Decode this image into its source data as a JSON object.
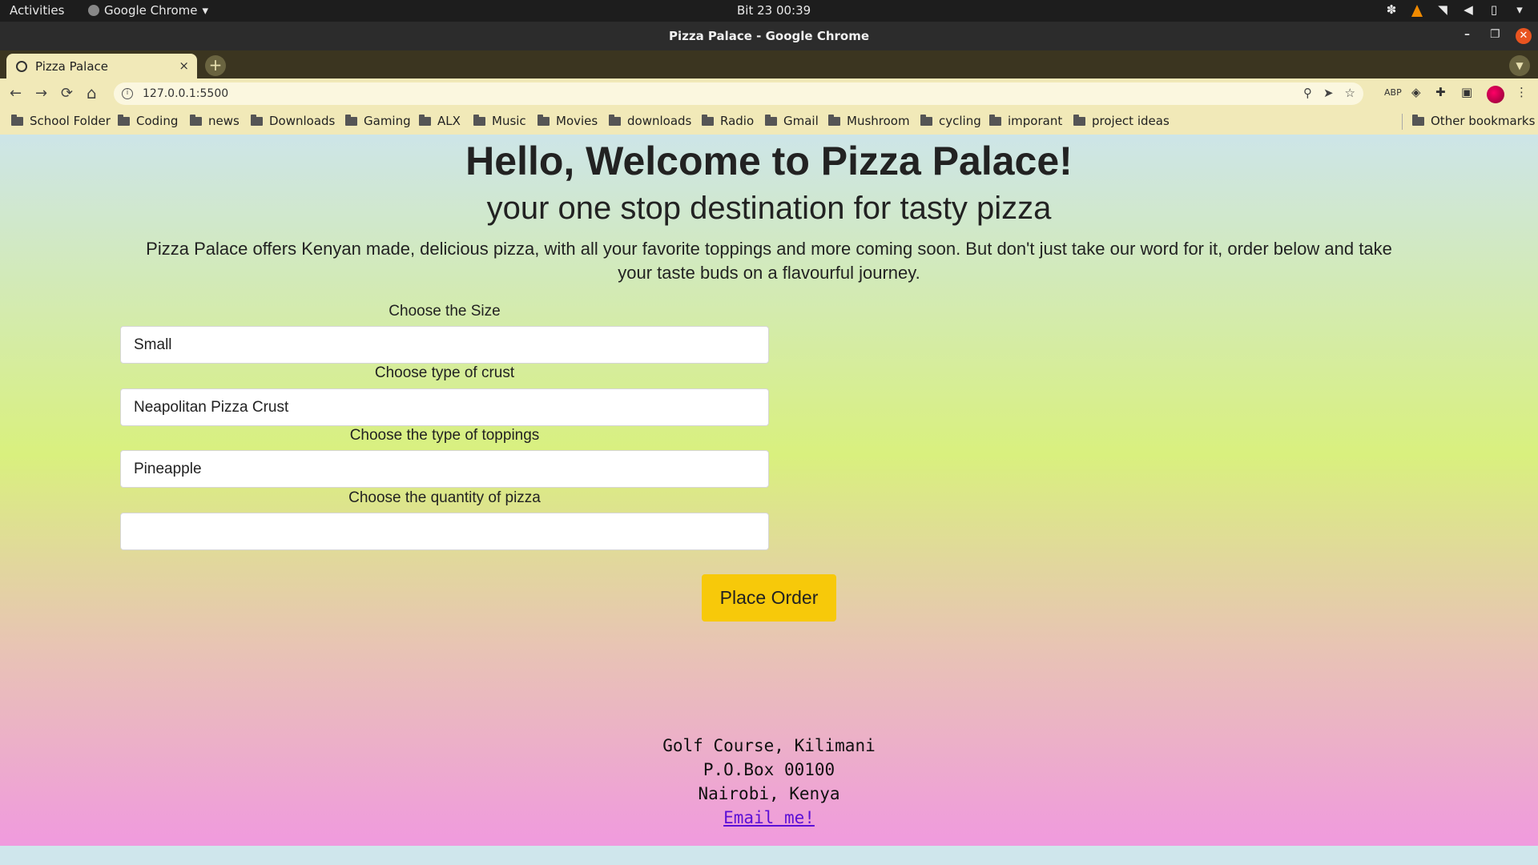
{
  "os": {
    "activities": "Activities",
    "app_name": "Google Chrome",
    "clock": "Bit 23  00:39"
  },
  "window": {
    "title": "Pizza Palace - Google Chrome"
  },
  "tab": {
    "title": "Pizza Palace",
    "close": "×"
  },
  "toolbar": {
    "url": "127.0.0.1:5500",
    "back": "←",
    "forward": "→",
    "reload": "⟳",
    "home": "⌂"
  },
  "bookmarks": [
    {
      "label": "School Folder"
    },
    {
      "label": "Coding"
    },
    {
      "label": "news"
    },
    {
      "label": "Downloads"
    },
    {
      "label": "Gaming"
    },
    {
      "label": "ALX"
    },
    {
      "label": "Music"
    },
    {
      "label": "Movies"
    },
    {
      "label": "downloads"
    },
    {
      "label": "Radio"
    },
    {
      "label": "Gmail"
    },
    {
      "label": "Mushroom"
    },
    {
      "label": "cycling"
    },
    {
      "label": "imporant"
    },
    {
      "label": "project ideas"
    }
  ],
  "other_bookmarks": "Other bookmarks",
  "page": {
    "heading": "Hello, Welcome to Pizza Palace!",
    "subheading": "your one stop destination for tasty pizza",
    "intro": "Pizza Palace offers Kenyan made, delicious pizza, with all your favorite toppings and more coming soon. But don't just take our word for it, order below and take your taste buds on a flavourful journey.",
    "form": {
      "size_label": "Choose the Size",
      "size_value": "Small",
      "crust_label": "Choose type of crust",
      "crust_value": "Neapolitan Pizza Crust",
      "toppings_label": "Choose the type of toppings",
      "toppings_value": "Pineapple",
      "quantity_label": "Choose the quantity of pizza",
      "quantity_value": "",
      "submit": "Place Order"
    },
    "footer": {
      "line1": "Golf Course, Kilimani",
      "line2": "P.O.Box 00100",
      "line3": "Nairobi, Kenya",
      "email_link": "Email me!"
    }
  },
  "colors": {
    "button": "#f7c90a",
    "link": "#5b0fd6",
    "gradient_top": "#cde5e8",
    "gradient_mid": "#d9f07e",
    "gradient_bottom": "#f09ade"
  }
}
